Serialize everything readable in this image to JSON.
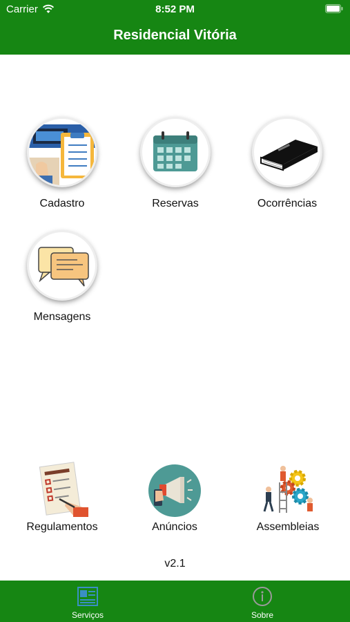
{
  "status_bar": {
    "carrier": "Carrier",
    "time": "8:52 PM"
  },
  "header": {
    "title": "Residencial Vitória"
  },
  "services": [
    {
      "label": "Cadastro",
      "icon": "registration-form-icon"
    },
    {
      "label": "Reservas",
      "icon": "calendar-icon"
    },
    {
      "label": "Ocorrências",
      "icon": "book-icon"
    },
    {
      "label": "Mensagens",
      "icon": "chat-bubbles-icon"
    }
  ],
  "bottom_links": [
    {
      "label": "Regulamentos",
      "icon": "checklist-icon"
    },
    {
      "label": "Anúncios",
      "icon": "megaphone-icon"
    },
    {
      "label": "Assembleias",
      "icon": "team-gears-icon"
    }
  ],
  "version": "v2.1",
  "tabbar": {
    "tabs": [
      {
        "label": "Serviços",
        "icon": "id-card-icon",
        "active": true
      },
      {
        "label": "Sobre",
        "icon": "info-icon",
        "active": false
      }
    ]
  },
  "colors": {
    "primary": "#168613",
    "tab_active_icon": "#3a8fc4"
  }
}
